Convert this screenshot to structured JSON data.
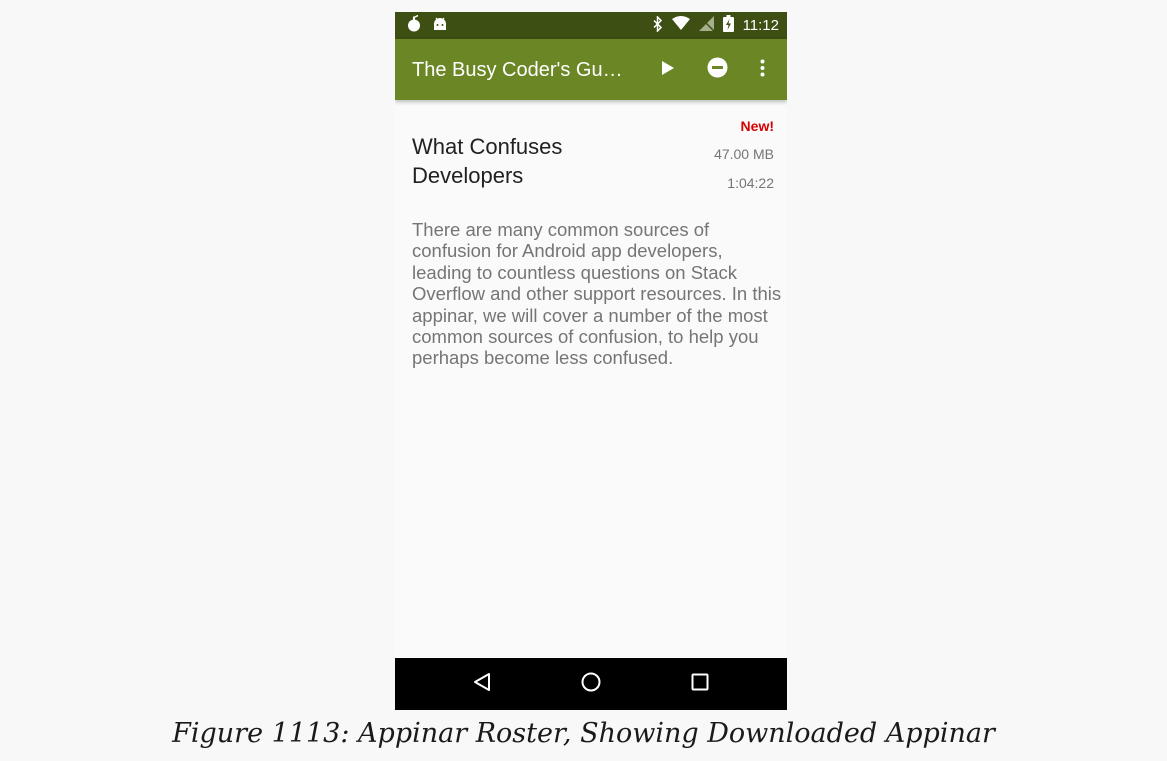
{
  "status_bar": {
    "time": "11:12",
    "icons_left": [
      "notification-bomb-icon",
      "android-icon"
    ],
    "icons_right": [
      "bluetooth-icon",
      "wifi-icon",
      "no-sim-icon",
      "battery-charging-icon"
    ]
  },
  "app_bar": {
    "title": "The Busy Coder's Gu…",
    "actions": [
      "play-icon",
      "remove-icon",
      "overflow-menu-icon"
    ]
  },
  "item": {
    "title": "What Confuses Developers",
    "badge": "New!",
    "size": "47.00 MB",
    "duration": "1:04:22",
    "description": "There are many common sources of confusion for Android app developers, leading to countless questions on Stack Overflow and other support resources. In this appinar, we will cover a number of the most common sources of confusion, to help you perhaps become less confused."
  },
  "nav_bar": {
    "buttons": [
      "back-icon",
      "home-icon",
      "recents-icon"
    ]
  },
  "caption": "Figure 1113: Appinar Roster, Showing Downloaded Appinar",
  "colors": {
    "status_bar": "#3d4f12",
    "app_bar": "#6b8624",
    "badge_new": "#d50000",
    "secondary_text": "#757575"
  }
}
